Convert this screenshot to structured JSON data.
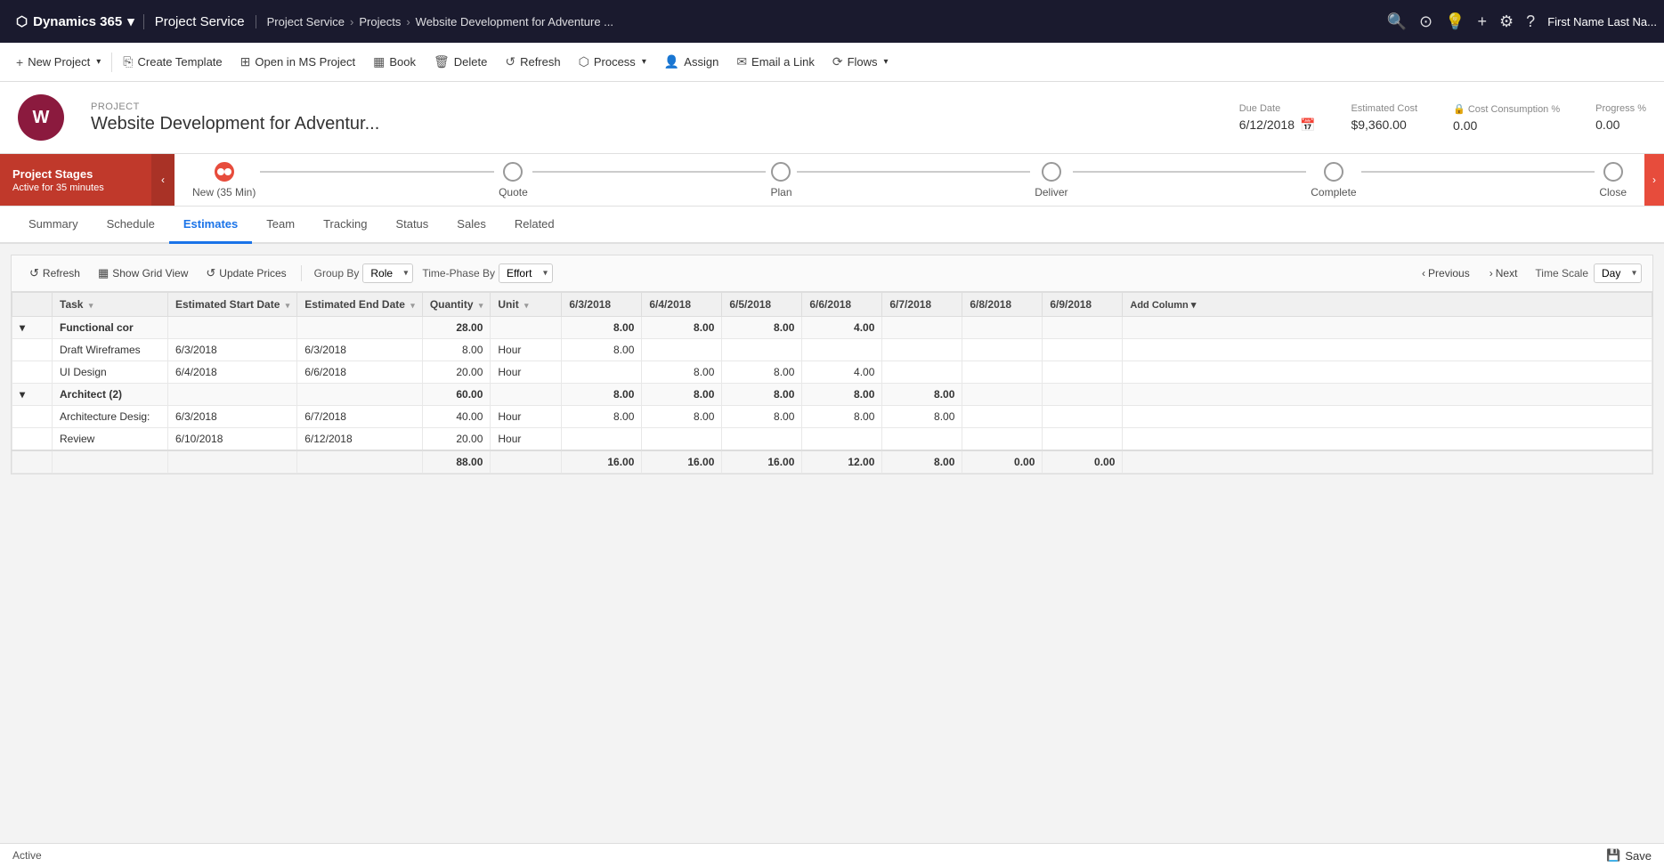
{
  "topNav": {
    "brand": "Dynamics 365",
    "chevron": "▾",
    "appName": "Project Service",
    "breadcrumb": [
      "Project Service",
      "Projects",
      "Website Development for Adventure ..."
    ],
    "icons": [
      "🔍",
      "⟳",
      "💡",
      "+"
    ],
    "settingsIcon": "⚙",
    "helpIcon": "?",
    "userName": "First Name Last Na..."
  },
  "commandBar": {
    "buttons": [
      {
        "id": "new-project",
        "icon": "+",
        "label": "New Project",
        "hasDropdown": true
      },
      {
        "id": "create-template",
        "icon": "⎘",
        "label": "Create Template",
        "hasDropdown": false
      },
      {
        "id": "open-ms-project",
        "icon": "⊞",
        "label": "Open in MS Project",
        "hasDropdown": false
      },
      {
        "id": "book",
        "icon": "📅",
        "label": "Book",
        "hasDropdown": false
      },
      {
        "id": "delete",
        "icon": "🗑",
        "label": "Delete",
        "hasDropdown": false
      },
      {
        "id": "refresh",
        "icon": "↺",
        "label": "Refresh",
        "hasDropdown": false
      },
      {
        "id": "process",
        "icon": "⬡",
        "label": "Process",
        "hasDropdown": true
      },
      {
        "id": "assign",
        "icon": "👤",
        "label": "Assign",
        "hasDropdown": false
      },
      {
        "id": "email-link",
        "icon": "✉",
        "label": "Email a Link",
        "hasDropdown": false
      },
      {
        "id": "flows",
        "icon": "⟳",
        "label": "Flows",
        "hasDropdown": true
      }
    ]
  },
  "project": {
    "label": "PROJECT",
    "name": "Website Development for Adventur...",
    "iconText": "W",
    "dueDate": {
      "label": "Due Date",
      "value": "6/12/2018"
    },
    "estimatedCost": {
      "label": "Estimated Cost",
      "value": "$9,360.00"
    },
    "costConsumption": {
      "label": "Cost Consumption %",
      "value": "0.00"
    },
    "progress": {
      "label": "Progress %",
      "value": "0.00"
    }
  },
  "projectStages": {
    "label": "Project Stages",
    "subLabel": "Active for 35 minutes",
    "stages": [
      {
        "id": "new",
        "label": "New (35 Min)",
        "active": true
      },
      {
        "id": "quote",
        "label": "Quote",
        "active": false
      },
      {
        "id": "plan",
        "label": "Plan",
        "active": false
      },
      {
        "id": "deliver",
        "label": "Deliver",
        "active": false
      },
      {
        "id": "complete",
        "label": "Complete",
        "active": false
      },
      {
        "id": "close",
        "label": "Close",
        "active": false
      }
    ]
  },
  "tabs": {
    "items": [
      {
        "id": "summary",
        "label": "Summary",
        "active": false
      },
      {
        "id": "schedule",
        "label": "Schedule",
        "active": false
      },
      {
        "id": "estimates",
        "label": "Estimates",
        "active": true
      },
      {
        "id": "team",
        "label": "Team",
        "active": false
      },
      {
        "id": "tracking",
        "label": "Tracking",
        "active": false
      },
      {
        "id": "status",
        "label": "Status",
        "active": false
      },
      {
        "id": "sales",
        "label": "Sales",
        "active": false
      },
      {
        "id": "related",
        "label": "Related",
        "active": false
      }
    ]
  },
  "gridToolbar": {
    "refresh": "Refresh",
    "showGridView": "Show Grid View",
    "updatePrices": "Update Prices",
    "groupByLabel": "Group By",
    "groupByValue": "Role",
    "timephaseByLabel": "Time-Phase By",
    "timephaseByValue": "Effort",
    "previous": "Previous",
    "next": "Next",
    "timescaleLabel": "Time Scale",
    "timescaleValue": "Day"
  },
  "tableHeaders": {
    "task": "Task",
    "estimatedStartDate": "Estimated Start Date",
    "estimatedEndDate": "Estimated End Date",
    "quantity": "Quantity",
    "unit": "Unit",
    "date1": "6/3/2018",
    "date2": "6/4/2018",
    "date3": "6/5/2018",
    "date4": "6/6/2018",
    "date5": "6/7/2018",
    "date6": "6/8/2018",
    "date7": "6/9/2018",
    "addColumn": "Add Column"
  },
  "tableData": {
    "groups": [
      {
        "id": "functional-con",
        "name": "Functional cor",
        "quantity": "28.00",
        "d1": "8.00",
        "d2": "8.00",
        "d3": "8.00",
        "d4": "4.00",
        "d5": "",
        "d6": "",
        "d7": "",
        "rows": [
          {
            "task": "Draft Wireframes",
            "startDate": "6/3/2018",
            "endDate": "6/3/2018",
            "quantity": "8.00",
            "unit": "Hour",
            "d1": "8.00",
            "d2": "",
            "d3": "",
            "d4": "",
            "d5": "",
            "d6": "",
            "d7": ""
          },
          {
            "task": "UI Design",
            "startDate": "6/4/2018",
            "endDate": "6/6/2018",
            "quantity": "20.00",
            "unit": "Hour",
            "d1": "",
            "d2": "8.00",
            "d3": "8.00",
            "d4": "4.00",
            "d5": "",
            "d6": "",
            "d7": ""
          }
        ]
      },
      {
        "id": "architect-2",
        "name": "Architect (2)",
        "quantity": "60.00",
        "d1": "8.00",
        "d2": "8.00",
        "d3": "8.00",
        "d4": "8.00",
        "d5": "8.00",
        "d6": "",
        "d7": "",
        "rows": [
          {
            "task": "Architecture Desig:",
            "startDate": "6/3/2018",
            "endDate": "6/7/2018",
            "quantity": "40.00",
            "unit": "Hour",
            "d1": "8.00",
            "d2": "8.00",
            "d3": "8.00",
            "d4": "8.00",
            "d5": "8.00",
            "d6": "",
            "d7": ""
          },
          {
            "task": "Review",
            "startDate": "6/10/2018",
            "endDate": "6/12/2018",
            "quantity": "20.00",
            "unit": "Hour",
            "d1": "",
            "d2": "",
            "d3": "",
            "d4": "",
            "d5": "",
            "d6": "",
            "d7": ""
          }
        ]
      }
    ],
    "footer": {
      "quantity": "88.00",
      "d1": "16.00",
      "d2": "16.00",
      "d3": "16.00",
      "d4": "12.00",
      "d5": "8.00",
      "d6": "0.00",
      "d7": "0.00"
    }
  },
  "statusBar": {
    "status": "Active",
    "saveLabel": "Save"
  }
}
